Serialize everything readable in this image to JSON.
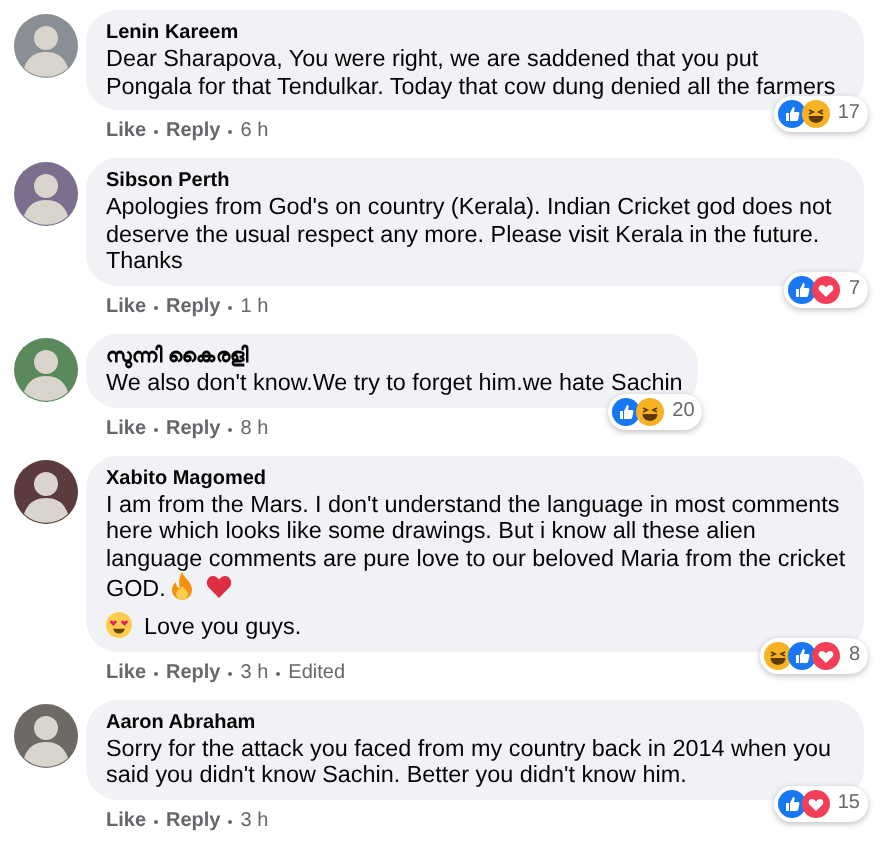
{
  "comments": [
    {
      "author": "Lenin Kareem",
      "paragraphs": [
        {
          "kind": "plain",
          "text": "Dear Sharapova, You were right, we are saddened that you put Pongala for that Tendulkar. Today that cow dung denied all the farmers"
        }
      ],
      "actions": [
        "Like",
        "Reply"
      ],
      "time": "6 h",
      "reactions": [
        {
          "kind": "like"
        },
        {
          "kind": "haha"
        }
      ],
      "reaction_count": "17"
    },
    {
      "author": "Sibson Perth",
      "paragraphs": [
        {
          "kind": "plain",
          "text": "Apologies from God's on country (Kerala). Indian Cricket god does not deserve the usual respect any more. Please visit Kerala in the future. Thanks"
        }
      ],
      "actions": [
        "Like",
        "Reply"
      ],
      "time": "1 h",
      "reactions": [
        {
          "kind": "like"
        },
        {
          "kind": "love"
        }
      ],
      "reaction_count": "7"
    },
    {
      "author": "സുന്നി കൈരളി",
      "paragraphs": [
        {
          "kind": "plain",
          "text": "We also don't know.We try to forget him.we hate Sachin"
        }
      ],
      "actions": [
        "Like",
        "Reply"
      ],
      "time": "8 h",
      "reactions": [
        {
          "kind": "like"
        },
        {
          "kind": "haha"
        }
      ],
      "reaction_count": "20"
    },
    {
      "author": "Xabito Magomed",
      "paragraphs": [
        {
          "kind": "emoji_end",
          "text": "I am from the Mars. I don't understand the language in most comments here which looks like some drawings. But i know all these alien language comments are pure love to our beloved Maria from the cricket GOD."
        },
        {
          "kind": "emoji_start",
          "text": "Love you guys."
        }
      ],
      "actions": [
        "Like",
        "Reply"
      ],
      "time": "3 h",
      "edited": "Edited",
      "reactions": [
        {
          "kind": "haha"
        },
        {
          "kind": "like"
        },
        {
          "kind": "love"
        }
      ],
      "reaction_count": "8"
    },
    {
      "author": "Aaron Abraham",
      "paragraphs": [
        {
          "kind": "plain",
          "text": "Sorry for the attack you faced from my country back in 2014 when you said you didn't know Sachin. Better you didn't know him."
        }
      ],
      "actions": [
        "Like",
        "Reply"
      ],
      "time": "3 h",
      "reactions": [
        {
          "kind": "like"
        },
        {
          "kind": "love"
        }
      ],
      "reaction_count": "15"
    }
  ]
}
